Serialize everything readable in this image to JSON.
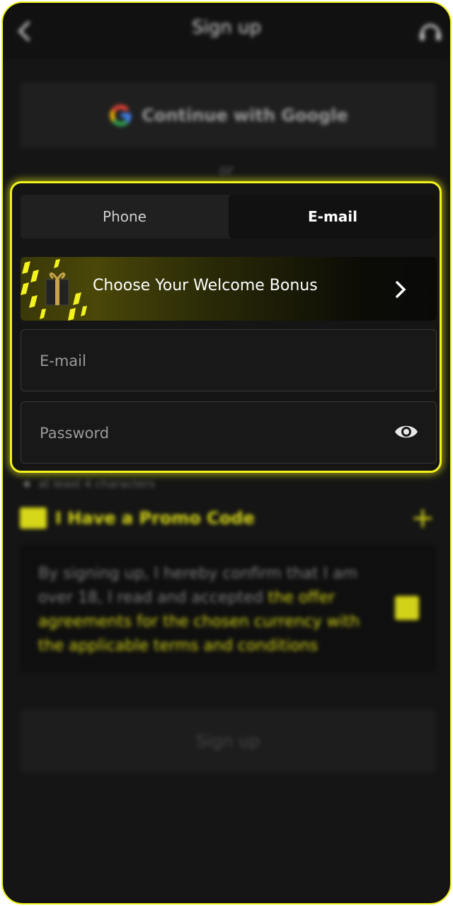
{
  "header": {
    "title": "Sign up",
    "back_icon": "chevron-left-icon",
    "support_icon": "headset-icon"
  },
  "social": {
    "google_label": "Continue with Google",
    "google_icon": "google-icon"
  },
  "divider": {
    "or_label": "or"
  },
  "tabs": {
    "items": [
      {
        "label": "Phone",
        "active": false
      },
      {
        "label": "E-mail",
        "active": true
      }
    ]
  },
  "bonus": {
    "label": "Choose Your Welcome Bonus",
    "icon": "gift-icon",
    "arrow_icon": "chevron-right-icon"
  },
  "fields": {
    "email": {
      "placeholder": "E-mail",
      "value": ""
    },
    "password": {
      "placeholder": "Password",
      "value": "",
      "eye_icon": "eye-icon"
    }
  },
  "password_hint": "at least 4 characters",
  "promo": {
    "label": "I Have a Promo Code",
    "icon": "ticket-icon",
    "plus_icon": "plus-icon"
  },
  "consent": {
    "text": "By signing up, I hereby confirm that I am over 18, I read and accepted ",
    "link_text": "the offer agreements for the chosen currency with the applicable terms and conditions",
    "checked": true
  },
  "submit": {
    "label": "Sign up"
  },
  "colors": {
    "accent": "#f2f21c",
    "background": "#151515",
    "panel": "#1f1f1f"
  }
}
